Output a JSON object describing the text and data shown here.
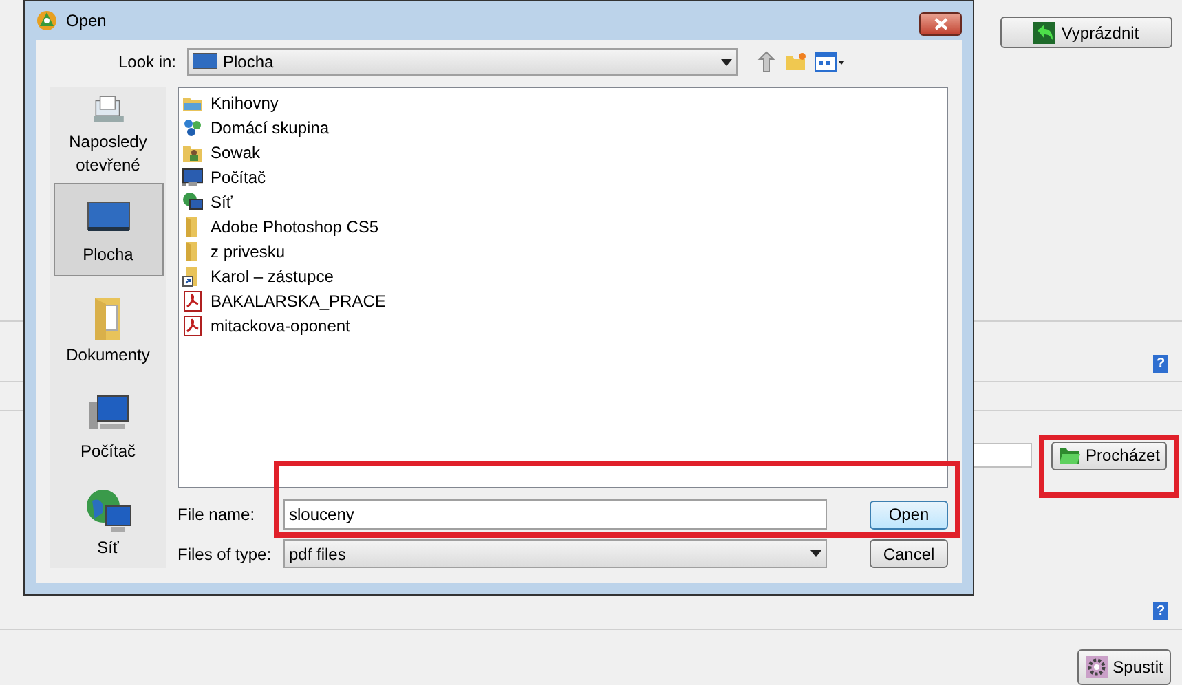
{
  "background": {
    "clear_button": "Vyprázdnit",
    "help_icons": [
      "?",
      "?"
    ],
    "browse_button": "Procházet",
    "run_button": "Spustit"
  },
  "dialog": {
    "title": "Open",
    "look_in_label": "Look in:",
    "look_in_value": "Plocha",
    "places": [
      {
        "label": "Naposledy otevřené",
        "kind": "recent",
        "selected": false
      },
      {
        "label": "Plocha",
        "kind": "desktop",
        "selected": true
      },
      {
        "label": "Dokumenty",
        "kind": "documents",
        "selected": false
      },
      {
        "label": "Počítač",
        "kind": "computer",
        "selected": false
      },
      {
        "label": "Síť",
        "kind": "network",
        "selected": false
      }
    ],
    "files": [
      {
        "name": "Knihovny",
        "kind": "library"
      },
      {
        "name": "Domácí skupina",
        "kind": "homegroup"
      },
      {
        "name": "Sowak",
        "kind": "user"
      },
      {
        "name": "Počítač",
        "kind": "computer"
      },
      {
        "name": "Síť",
        "kind": "network"
      },
      {
        "name": "Adobe Photoshop CS5",
        "kind": "folder"
      },
      {
        "name": "z privesku",
        "kind": "folder"
      },
      {
        "name": "Karol – zástupce",
        "kind": "shortcut"
      },
      {
        "name": "BAKALARSKA_PRACE",
        "kind": "pdf"
      },
      {
        "name": "mitackova-oponent",
        "kind": "pdf"
      }
    ],
    "file_name_label": "File name:",
    "file_name_value": "slouceny",
    "file_type_label": "Files of type:",
    "file_type_value": "pdf files",
    "open_button": "Open",
    "cancel_button": "Cancel"
  }
}
